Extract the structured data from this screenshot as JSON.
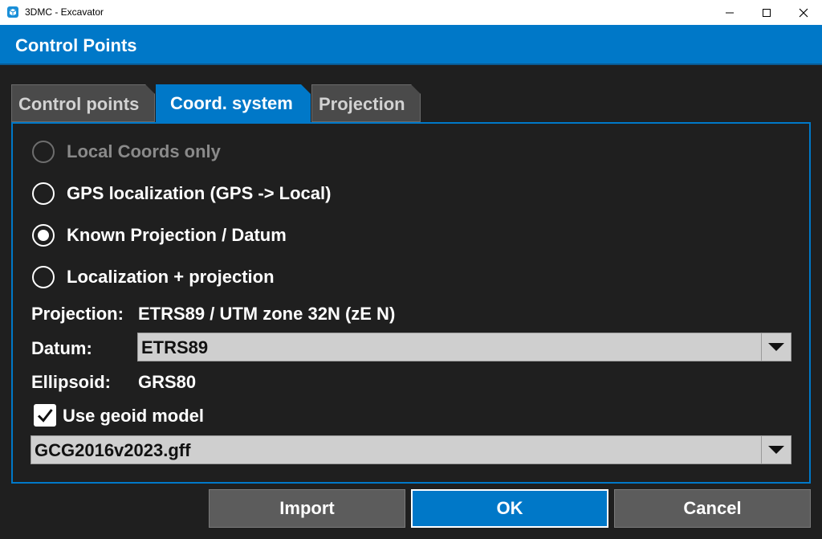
{
  "window": {
    "title": "3DMC - Excavator",
    "icon": "cube-app-icon"
  },
  "header": {
    "title": "Control Points"
  },
  "tabs": [
    {
      "label": "Control points",
      "active": false
    },
    {
      "label": "Coord. system",
      "active": true
    },
    {
      "label": "Projection",
      "active": false
    }
  ],
  "options": [
    {
      "label": "Local Coords only",
      "selected": false,
      "disabled": true
    },
    {
      "label": "GPS localization (GPS -> Local)",
      "selected": false,
      "disabled": false
    },
    {
      "label": "Known Projection / Datum",
      "selected": true,
      "disabled": false
    },
    {
      "label": "Localization + projection",
      "selected": false,
      "disabled": false
    }
  ],
  "projection": {
    "label": "Projection:",
    "value": "ETRS89 / UTM zone 32N (zE N)"
  },
  "datum": {
    "label": "Datum:",
    "value": "ETRS89"
  },
  "ellipsoid": {
    "label": "Ellipsoid:",
    "value": "GRS80"
  },
  "geoid": {
    "label": "Use geoid model",
    "checked": true,
    "file": "GCG2016v2023.gff"
  },
  "buttons": {
    "import": "Import",
    "ok": "OK",
    "cancel": "Cancel"
  },
  "colors": {
    "accent": "#0078c8",
    "background": "#1f1f1f",
    "button": "#5c5c5c"
  }
}
